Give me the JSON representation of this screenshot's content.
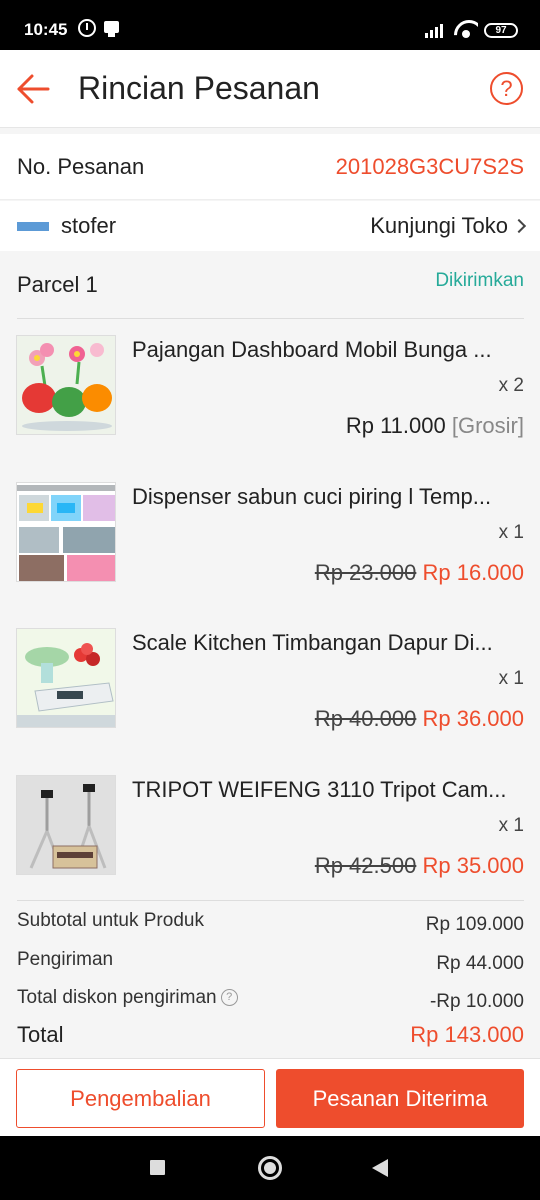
{
  "status_bar": {
    "time": "10:45",
    "battery": "97"
  },
  "header": {
    "title": "Rincian Pesanan",
    "help_label": "?"
  },
  "order": {
    "label": "No. Pesanan",
    "number": "201028G3CU7S2S"
  },
  "shop": {
    "name": "stofer",
    "visit_label": "Kunjungi Toko"
  },
  "parcel": {
    "title": "Parcel 1",
    "status": "Dikirimkan",
    "items": [
      {
        "name": "Pajangan Dashboard Mobil Bunga ...",
        "qty": "x 2",
        "old_price": "",
        "price": "Rp 11.000",
        "tag": "[Grosir]"
      },
      {
        "name": "Dispenser sabun cuci piring l Temp...",
        "qty": "x 1",
        "old_price": "Rp 23.000",
        "price": "Rp 16.000",
        "tag": ""
      },
      {
        "name": "Scale Kitchen Timbangan Dapur Di...",
        "qty": "x 1",
        "old_price": "Rp 40.000",
        "price": "Rp 36.000",
        "tag": ""
      },
      {
        "name": "TRIPOT WEIFENG 3110 Tripot Cam...",
        "qty": "x 1",
        "old_price": "Rp 42.500",
        "price": "Rp 35.000",
        "tag": ""
      }
    ]
  },
  "summary": {
    "subtotal_label": "Subtotal untuk Produk",
    "subtotal_value": "Rp 109.000",
    "shipping_label": "Pengiriman",
    "shipping_value": "Rp 44.000",
    "discount_label": "Total diskon pengiriman",
    "discount_value": "-Rp 10.000",
    "total_label": "Total",
    "total_value": "Rp 143.000"
  },
  "actions": {
    "return_label": "Pengembalian",
    "received_label": "Pesanan Diterima"
  },
  "colors": {
    "accent": "#ee4d2d",
    "status_green": "#26aa99"
  }
}
